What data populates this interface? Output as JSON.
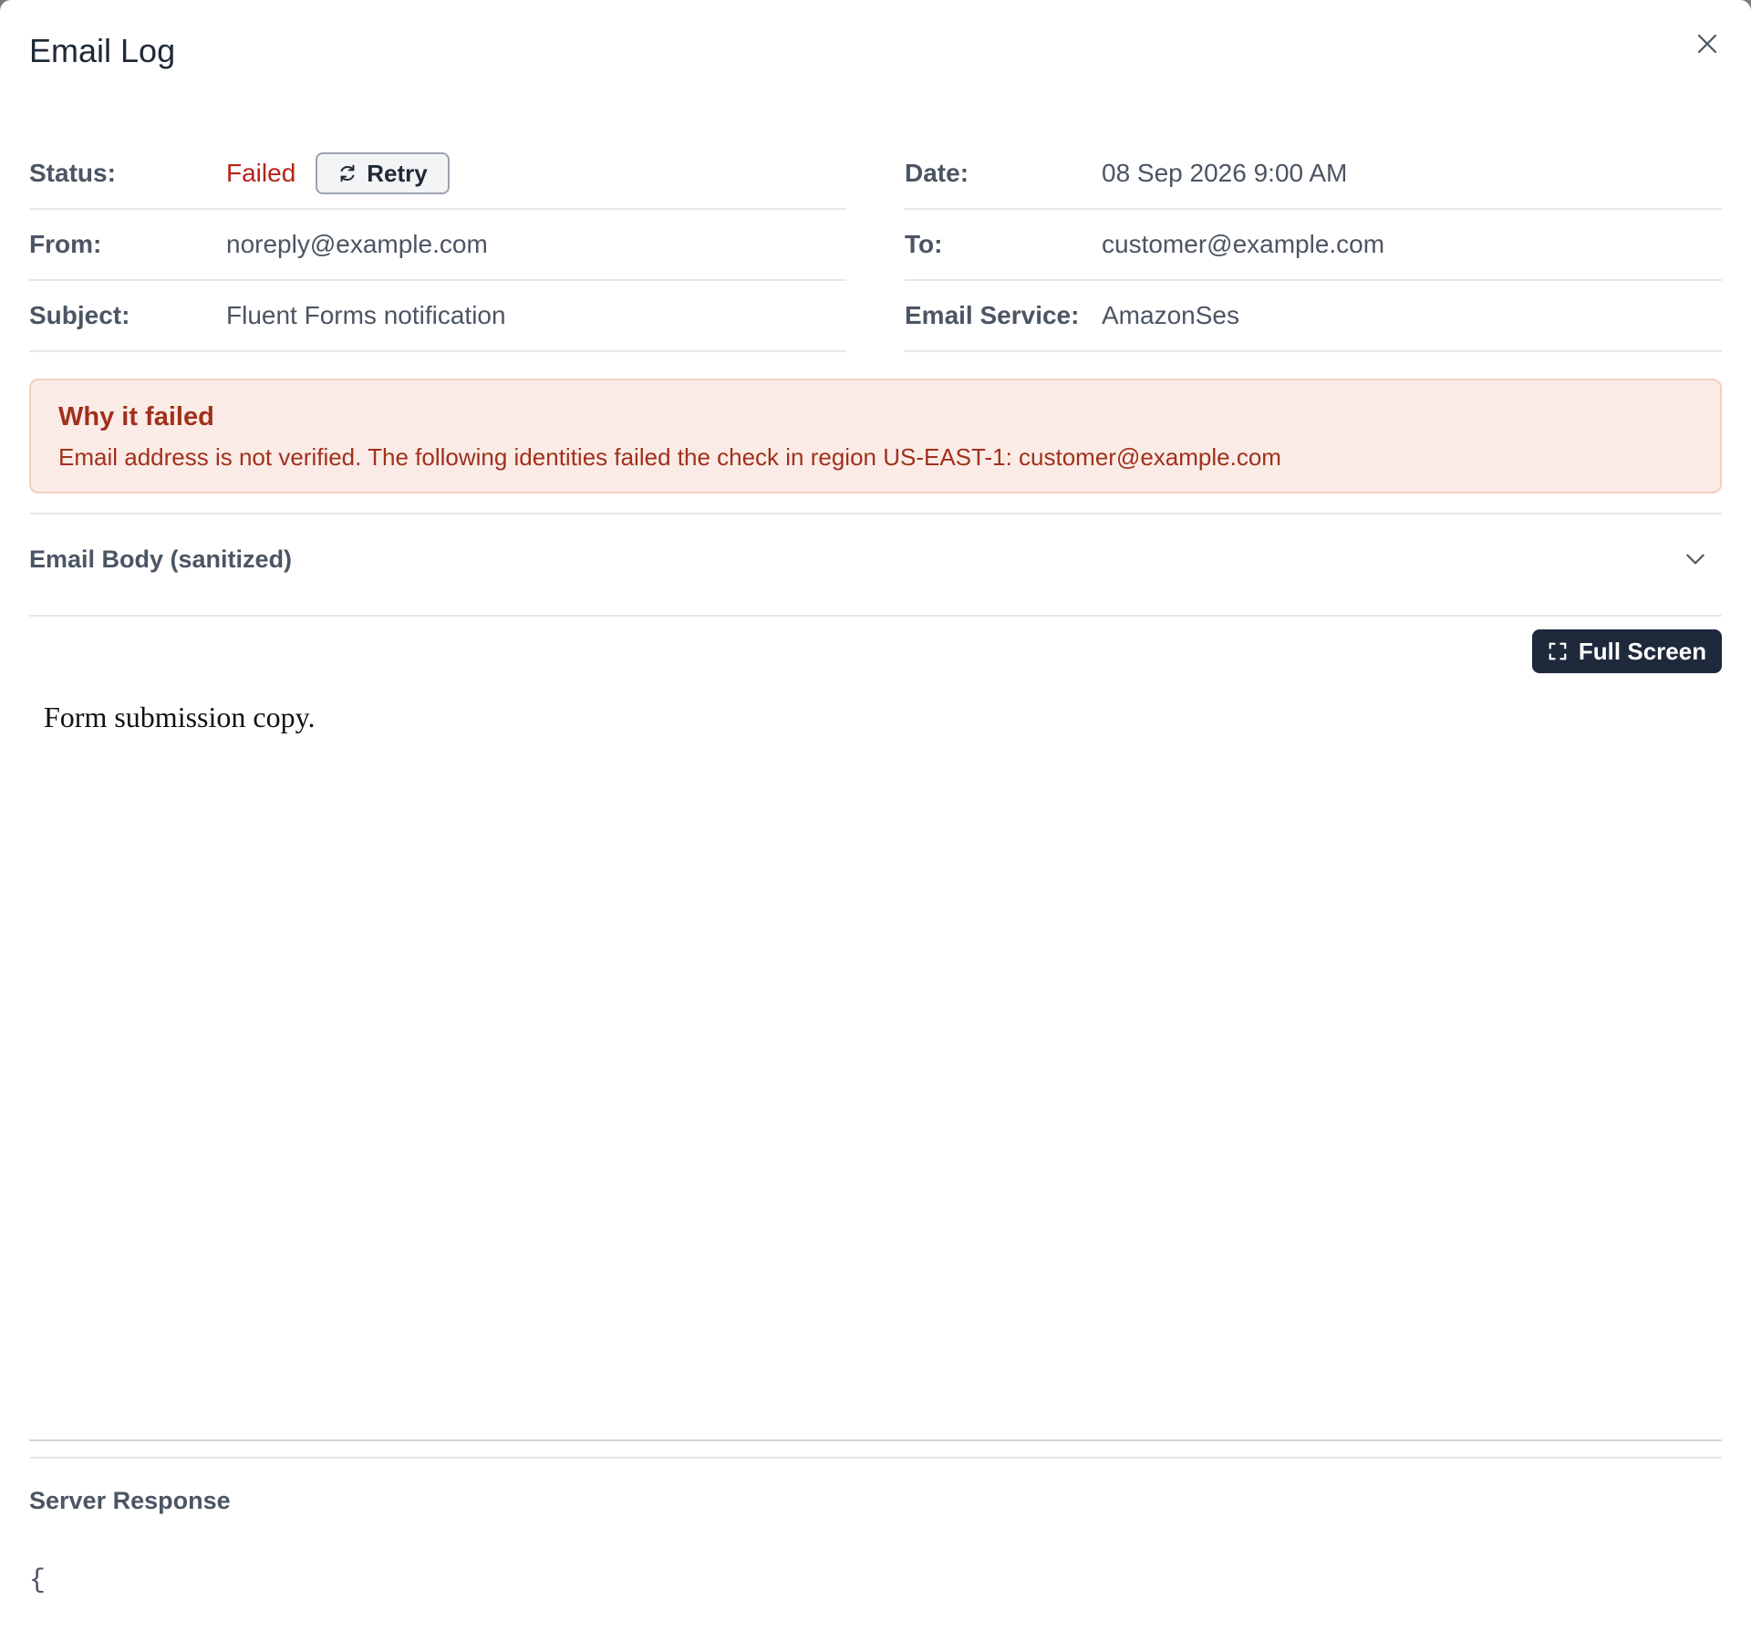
{
  "modal": {
    "title": "Email Log"
  },
  "fields": {
    "status": {
      "label": "Status:",
      "value": "Failed",
      "retry_label": "Retry"
    },
    "date": {
      "label": "Date:",
      "value": "08 Sep 2026 9:00 AM"
    },
    "from": {
      "label": "From:",
      "value": "noreply@example.com"
    },
    "to": {
      "label": "To:",
      "value": "customer@example.com"
    },
    "subject": {
      "label": "Subject:",
      "value": "Fluent Forms notification"
    },
    "service": {
      "label": "Email Service:",
      "value": "AmazonSes"
    }
  },
  "error": {
    "title": "Why it failed",
    "message": "Email address is not verified. The following identities failed the check in region US-EAST-1: customer@example.com"
  },
  "email_body": {
    "title": "Email Body (sanitized)",
    "fullscreen_label": "Full Screen",
    "content": "Form submission copy."
  },
  "server_response": {
    "title": "Server Response",
    "content": "{"
  },
  "colors": {
    "failed": "#b42318",
    "error_bg": "#fbebe7",
    "dark_button": "#1e293b"
  },
  "icons": {
    "close": "close-icon",
    "retry": "refresh-icon",
    "expand": "chevron-down-icon",
    "fullscreen": "fullscreen-icon"
  }
}
